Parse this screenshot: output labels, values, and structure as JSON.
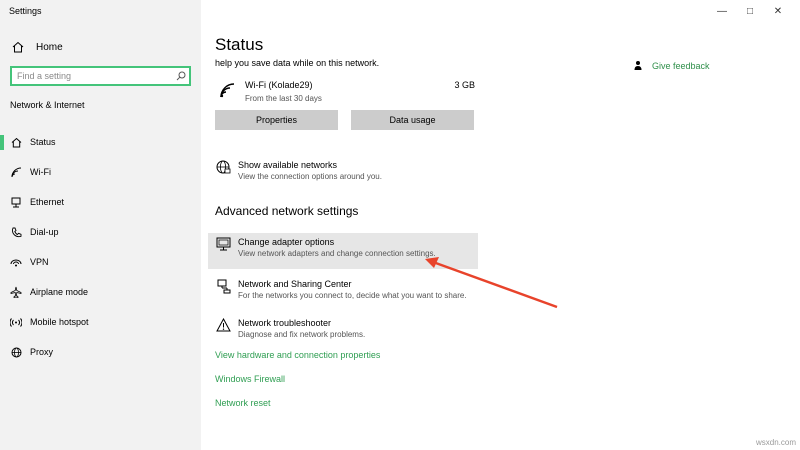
{
  "window": {
    "title": "Settings",
    "controls": [
      "—",
      "□",
      "✕"
    ]
  },
  "sidebar": {
    "home_label": "Home",
    "search_placeholder": "Find a setting",
    "section_title": "Network & Internet",
    "items": [
      {
        "label": "Status",
        "icon": "home-status-icon",
        "active": true
      },
      {
        "label": "Wi-Fi",
        "icon": "wifi-icon"
      },
      {
        "label": "Ethernet",
        "icon": "ethernet-icon"
      },
      {
        "label": "Dial-up",
        "icon": "phone-icon"
      },
      {
        "label": "VPN",
        "icon": "vpn-icon"
      },
      {
        "label": "Airplane mode",
        "icon": "airplane-icon"
      },
      {
        "label": "Mobile hotspot",
        "icon": "hotspot-icon"
      },
      {
        "label": "Proxy",
        "icon": "globe-icon"
      }
    ]
  },
  "main": {
    "title": "Status",
    "partial_text": "help you save data while on this network.",
    "feedback_label": "Give feedback",
    "wifi": {
      "name": "Wi-Fi (Kolade29)",
      "sub": "From the last 30 days",
      "usage": "3 GB"
    },
    "buttons": {
      "properties": "Properties",
      "data_usage": "Data usage"
    },
    "show_networks": {
      "title": "Show available networks",
      "sub": "View the connection options around you."
    },
    "advanced_title": "Advanced network settings",
    "adapter": {
      "title": "Change adapter options",
      "sub": "View network adapters and change connection settings."
    },
    "sharing": {
      "title": "Network and Sharing Center",
      "sub": "For the networks you connect to, decide what you want to share."
    },
    "troubleshooter": {
      "title": "Network troubleshooter",
      "sub": "Diagnose and fix network problems."
    },
    "links": {
      "hardware": "View hardware and connection properties",
      "firewall": "Windows Firewall",
      "reset": "Network reset"
    }
  },
  "watermark": "wsxdn.com",
  "colors": {
    "accent": "#44c47a",
    "link": "#2f9e52",
    "arrow": "#e8432b",
    "sidebar_bg": "#f2f2f2"
  }
}
